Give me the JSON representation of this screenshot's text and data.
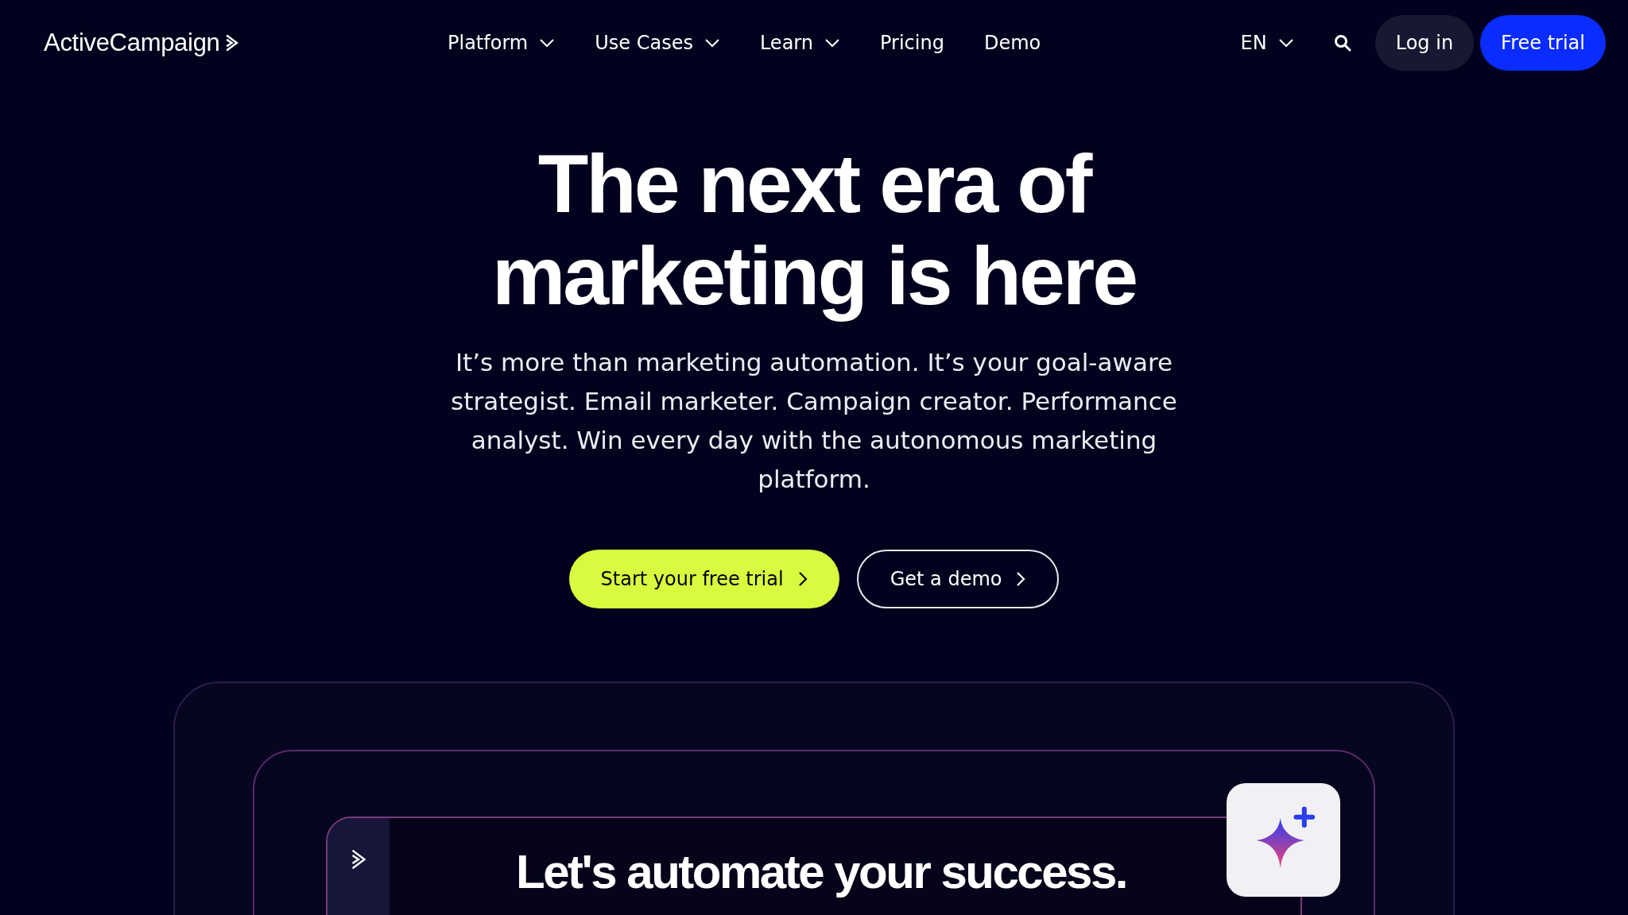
{
  "header": {
    "logo": "ActiveCampaign",
    "nav": [
      {
        "label": "Platform",
        "dropdown": true
      },
      {
        "label": "Use Cases",
        "dropdown": true
      },
      {
        "label": "Learn",
        "dropdown": true
      },
      {
        "label": "Pricing",
        "dropdown": false
      },
      {
        "label": "Demo",
        "dropdown": false
      }
    ],
    "language": "EN",
    "login": "Log in",
    "cta": "Free trial"
  },
  "hero": {
    "headline": [
      "The next era of",
      "marketing is here"
    ],
    "subtitle": "It’s more than marketing automation. It’s your goal-aware strategist. Email marketer. Campaign creator. Performance analyst. Win every day with the autonomous marketing platform.",
    "buttons": [
      {
        "label": "Start your free trial",
        "kind": "primary"
      },
      {
        "label": "Get a demo",
        "kind": "outline"
      }
    ]
  },
  "preview": {
    "heading": "Let's automate your success."
  }
}
